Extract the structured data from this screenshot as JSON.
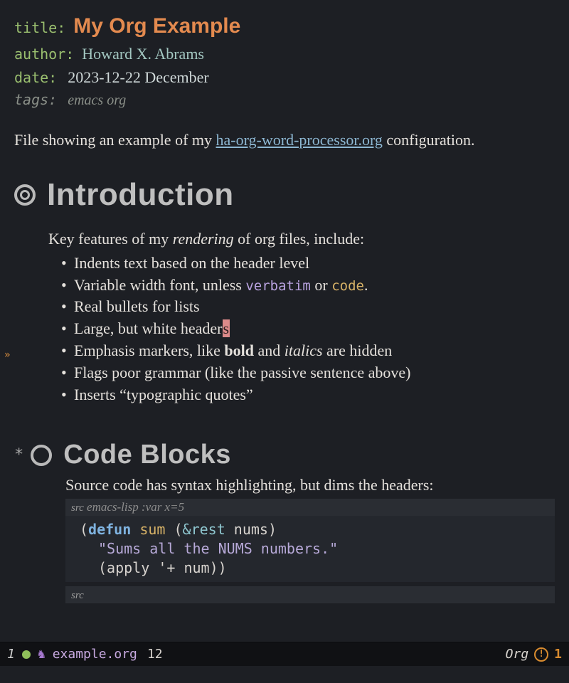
{
  "meta": {
    "title_key": "title:",
    "title_val": "My Org Example",
    "author_key": "author:",
    "author_val": "Howard X. Abrams",
    "date_key": "date:",
    "date_val": "2023-12-22 December",
    "tags_key": "tags:",
    "tags_val": "emacs org"
  },
  "intro": {
    "pre_link": "File showing an example of my ",
    "link": "ha-org-word-processor.org",
    "post_link": " configuration."
  },
  "sections": {
    "intro_heading": "Introduction",
    "code_heading": "Code Blocks",
    "star": "*"
  },
  "features": {
    "lead_pre": "Key features of my ",
    "lead_em": "rendering",
    "lead_post": " of org files, include:",
    "items": [
      {
        "text": "Indents text based on the header level"
      },
      {
        "pre": "Variable width font, unless ",
        "verbatim": "verbatim",
        "mid": " or ",
        "code": "code",
        "post": "."
      },
      {
        "text": "Real bullets for lists"
      },
      {
        "pre": "Large, but white header",
        "cursor": "s"
      },
      {
        "pre": "Emphasis markers, like ",
        "bold": "bold",
        "mid": " and ",
        "italic": "italics",
        "post": " are hidden"
      },
      {
        "text": "Flags poor grammar (like the passive sentence above)"
      },
      {
        "text": "Inserts “typographic quotes”"
      }
    ]
  },
  "codeblock": {
    "caption": "Source code has syntax highlighting, but dims the headers:",
    "src_kw": "src",
    "header_args": " emacs-lisp :var x=5",
    "line1": {
      "defun": "defun",
      "name": "sum",
      "rest": "&rest",
      "arg": "nums"
    },
    "line2": "\"Sums all the NUMS numbers.\"",
    "line3_apply": "apply",
    "line3_sym": "'+",
    "line3_arg": "num"
  },
  "gutter": {
    "arrow": "»"
  },
  "modeline": {
    "winnum": "1",
    "unicorn": "♞",
    "filename": "example.org",
    "linenum": "12",
    "mode": "Org",
    "warn_count": "1",
    "warn_glyph": "!"
  }
}
